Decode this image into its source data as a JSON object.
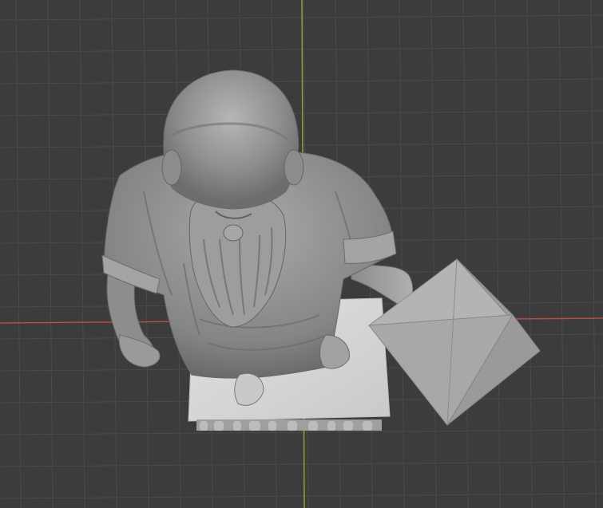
{
  "viewport": {
    "background": "#3c3c3c",
    "grid_color": "#4a4a4a",
    "x_axis_color": "#b84b4b",
    "y_axis_color": "#8fa22d"
  },
  "scene": {
    "statue": {
      "material_color": "#9c9c9c",
      "highlight_color": "#c8c8c8",
      "shadow_color": "#6e6e6e"
    },
    "pedestal": {
      "color": "#d6d6d6"
    },
    "octahedron": {
      "color": "#a8a8a8"
    }
  }
}
